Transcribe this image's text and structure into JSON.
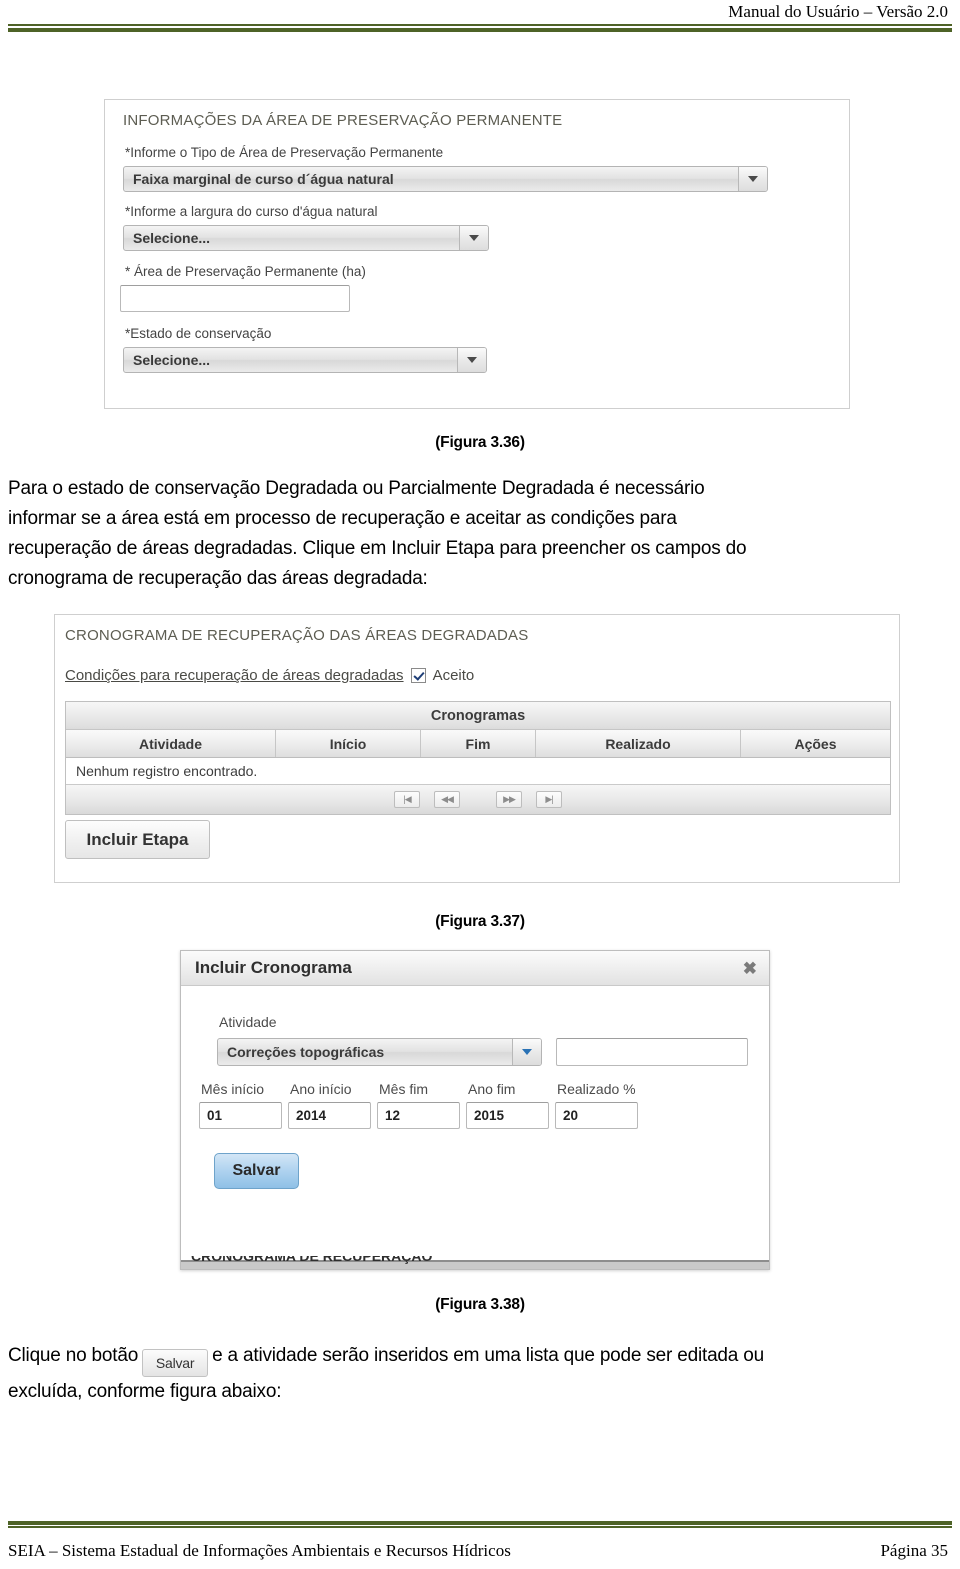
{
  "header": {
    "title": "Manual do Usuário – Versão 2.0"
  },
  "footer": {
    "text": "SEIA – Sistema Estadual de Informações Ambientais e Recursos Hídricos",
    "page": "Página 35"
  },
  "figure_336": {
    "legend": "INFORMAÇÕES DA ÁREA DE PRESERVAÇÃO PERMANENTE",
    "label_tipo": "*Informe o Tipo de Área de Preservação Permanente",
    "select_tipo_value": "Faixa marginal de curso d´água natural",
    "label_largura": "*Informe a largura do curso d'água natural",
    "select_largura_value": "Selecione...",
    "label_area": "* Área de Preservação Permanente (ha)",
    "input_area_value": "",
    "label_estado": "*Estado de conservação",
    "select_estado_value": "Selecione...",
    "caption": "(Figura 3.36)"
  },
  "paragraph_1": {
    "line1": "Para o estado de conservação Degradada ou Parcialmente Degradada é necessário",
    "line2": "informar se a área está em processo de recuperação e aceitar as condições para",
    "line3": "recuperação de áreas degradadas. Clique em Incluir Etapa para preencher os campos do",
    "line4": "cronograma de recuperação das áreas degradada:"
  },
  "figure_337": {
    "legend": "CRONOGRAMA DE RECUPERAÇÃO DAS ÁREAS DEGRADADAS",
    "condicoes_link": "Condições para recuperação de áreas degradadas",
    "aceito_label": "Aceito",
    "grid_title": "Cronogramas",
    "columns": [
      "Atividade",
      "Início",
      "Fim",
      "Realizado",
      "Ações"
    ],
    "empty_message": "Nenhum registro encontrado.",
    "pager": [
      "|◀",
      "◀◀",
      "▶▶",
      "▶|"
    ],
    "incluir_etapa_button": "Incluir Etapa",
    "caption": "(Figura 3.37)"
  },
  "figure_338": {
    "dialog_title": "Incluir Cronograma",
    "close_icon": "✖",
    "atividade_label": "Atividade",
    "atividade_select_value": "Correções topográficas",
    "atividade_text_value": "",
    "fields": [
      {
        "label": "Mês início",
        "value": "01"
      },
      {
        "label": "Ano início",
        "value": "2014"
      },
      {
        "label": "Mês fim",
        "value": "12"
      },
      {
        "label": "Ano fim",
        "value": "2015"
      },
      {
        "label": "Realizado %",
        "value": "20"
      }
    ],
    "salvar_button": "Salvar",
    "clipped_text": "CRONOGRAMA DE RECUPERAÇÃO",
    "caption": "(Figura 3.38)"
  },
  "paragraph_2": {
    "before": "Clique no botão",
    "chip": "Salvar",
    "after": "e a atividade serão inseridos em uma lista que pode ser editada ou",
    "line2": "excluída, conforme figura abaixo:"
  },
  "colors": {
    "rule_green": "#4e6327",
    "accent_blue": "#2a72b5",
    "legend_text": "#5d5d52"
  }
}
